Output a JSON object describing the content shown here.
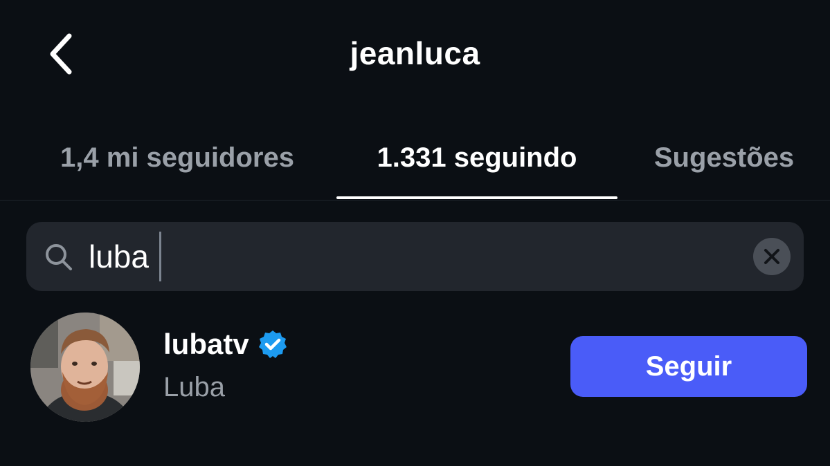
{
  "header": {
    "title": "jeanluca",
    "back_icon": "chevron-left-icon"
  },
  "tabs": [
    {
      "label": "1,4 mi seguidores",
      "active": false
    },
    {
      "label": "1.331 seguindo",
      "active": true
    },
    {
      "label": "Sugestões",
      "active": false
    }
  ],
  "search": {
    "value": "luba",
    "search_icon": "search-icon",
    "clear_icon": "clear-icon"
  },
  "results": [
    {
      "username": "lubatv",
      "verified": true,
      "full_name": "Luba",
      "action_label": "Seguir"
    }
  ],
  "colors": {
    "background": "#0b0f14",
    "search_bg": "#22262d",
    "accent": "#4a5cf8",
    "verified": "#1d9bf0",
    "muted_text": "#9aa0a8"
  }
}
